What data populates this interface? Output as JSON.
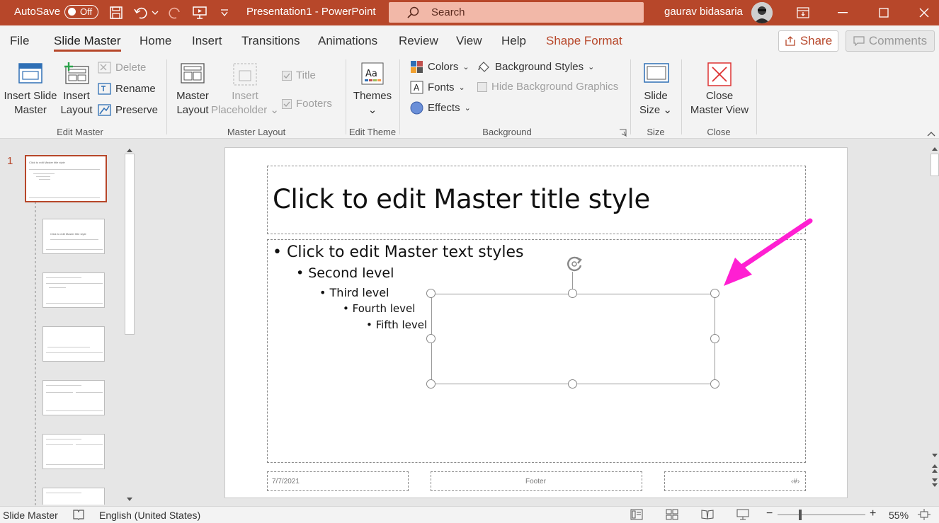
{
  "titlebar": {
    "autosave_label": "AutoSave",
    "autosave_state": "Off",
    "doc_title": "Presentation1  -  PowerPoint",
    "search_placeholder": "Search",
    "user_name": "gaurav bidasaria"
  },
  "tabs": [
    "File",
    "Slide Master",
    "Home",
    "Insert",
    "Transitions",
    "Animations",
    "Review",
    "View",
    "Help",
    "Shape Format"
  ],
  "active_tab": "Slide Master",
  "share_label": "Share",
  "comments_label": "Comments",
  "ribbon": {
    "edit_master": {
      "label": "Edit Master",
      "insert_slide_master": [
        "Insert Slide",
        "Master"
      ],
      "insert_layout": [
        "Insert",
        "Layout"
      ],
      "delete": "Delete",
      "rename": "Rename",
      "preserve": "Preserve"
    },
    "master_layout": {
      "label": "Master Layout",
      "master_layout_btn": [
        "Master",
        "Layout"
      ],
      "insert_placeholder": [
        "Insert",
        "Placeholder"
      ],
      "title_chk": "Title",
      "footers_chk": "Footers"
    },
    "edit_theme": {
      "label": "Edit Theme",
      "themes": "Themes"
    },
    "background": {
      "label": "Background",
      "colors": "Colors",
      "fonts": "Fonts",
      "effects": "Effects",
      "background_styles": "Background Styles",
      "hide_bg_graphics": "Hide Background Graphics"
    },
    "size": {
      "label": "Size",
      "slide_size": [
        "Slide",
        "Size"
      ]
    },
    "close": {
      "label": "Close",
      "close_master_view": [
        "Close",
        "Master View"
      ]
    }
  },
  "thumbnails": {
    "number": "1",
    "master_title": "Click to edit Master title style",
    "layout_title": "Click to edit Master title style"
  },
  "slide": {
    "title": "Click to edit Master title style",
    "level1": "Click to edit Master text styles",
    "level2": "Second level",
    "level3": "Third level",
    "level4": "Fourth level",
    "level5": "Fifth level",
    "date": "7/7/2021",
    "footer": "Footer",
    "page_num": "‹#›"
  },
  "statusbar": {
    "view_name": "Slide Master",
    "language": "English (United States)",
    "zoom": "55%"
  },
  "colors": {
    "accent": "#b7472a",
    "arrow": "#ff1fd2"
  }
}
